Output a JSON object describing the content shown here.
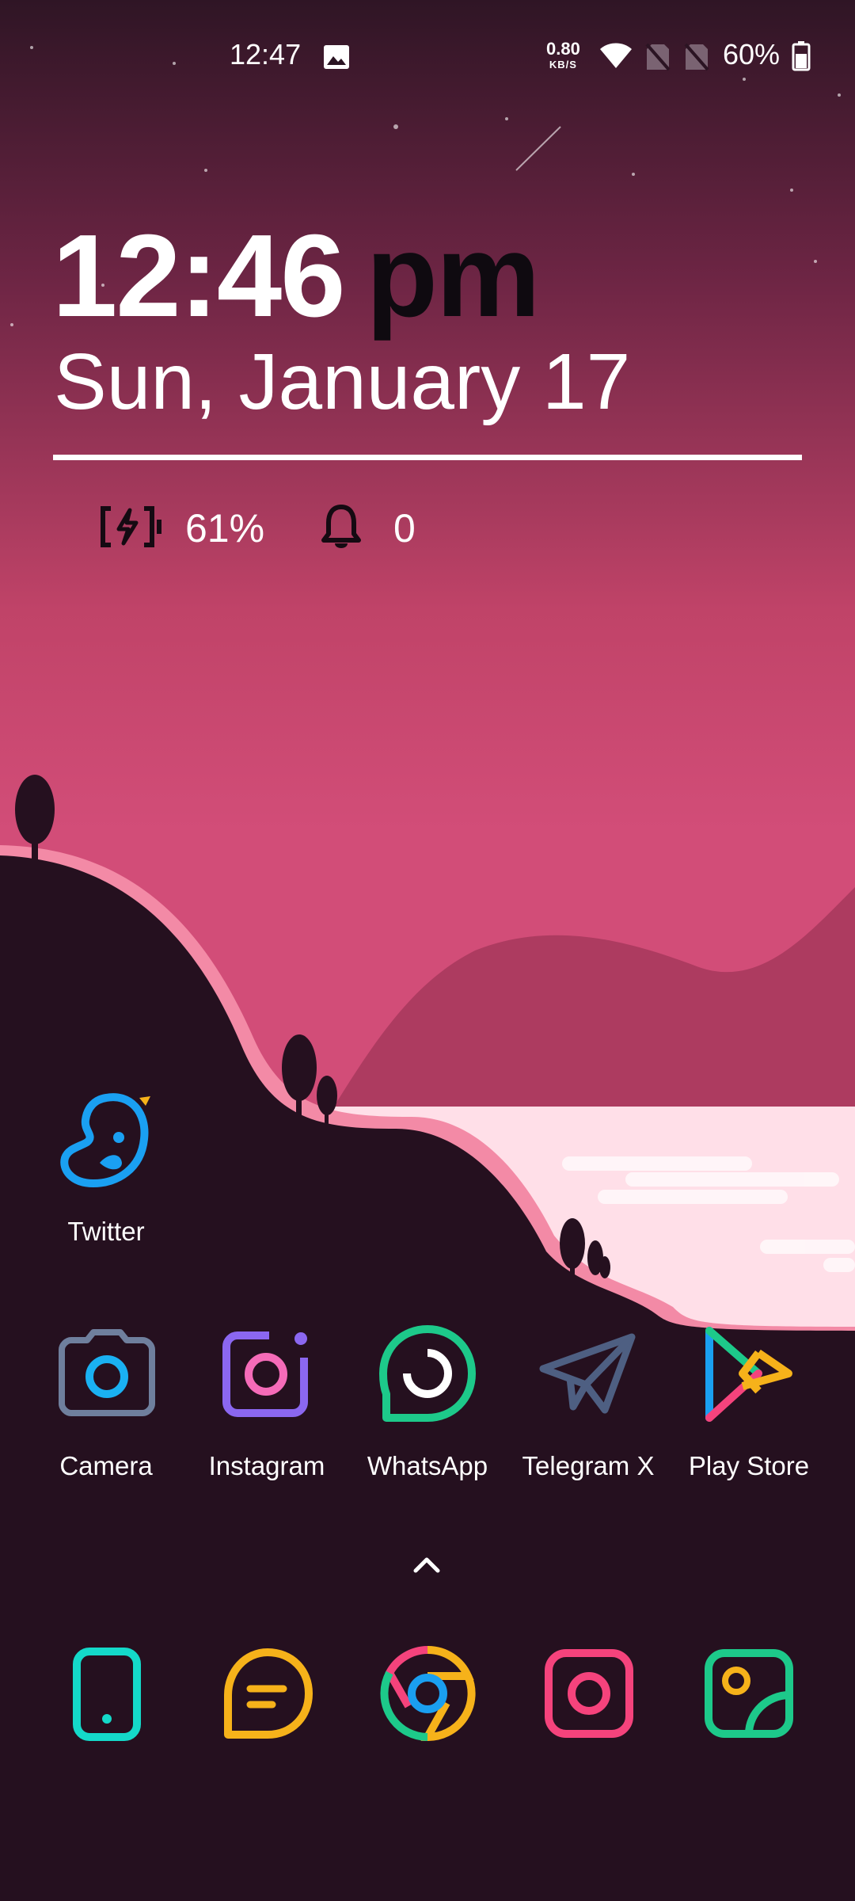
{
  "status_bar": {
    "time": "12:47",
    "net_speed_value": "0.80",
    "net_speed_unit": "KB/S",
    "battery_percent": "60%",
    "icons": [
      "gallery-notification-icon",
      "wifi-icon",
      "no-sim-icon",
      "no-sim-icon",
      "battery-icon"
    ]
  },
  "clock_widget": {
    "time": "12:46",
    "ampm": "pm",
    "date": "Sun, January 17",
    "battery_percent": "61%",
    "notification_count": "0"
  },
  "apps_row1": [
    {
      "label": "Twitter",
      "icon": "twitter-icon"
    }
  ],
  "apps_row2": [
    {
      "label": "Camera",
      "icon": "camera-icon"
    },
    {
      "label": "Instagram",
      "icon": "instagram-icon"
    },
    {
      "label": "WhatsApp",
      "icon": "whatsapp-icon"
    },
    {
      "label": "Telegram X",
      "icon": "telegram-icon"
    },
    {
      "label": "Play Store",
      "icon": "play-store-icon"
    }
  ],
  "dock": [
    "phone-icon",
    "messages-icon",
    "chrome-icon",
    "camera-icon",
    "gallery-icon"
  ],
  "colors": {
    "sky_top": "#2f1525",
    "sky_bottom": "#d24d78",
    "hill": "#25101f",
    "hill_rim": "#f38aa6",
    "lake": "#ffdfe8",
    "far_hill": "#ad3b60"
  }
}
